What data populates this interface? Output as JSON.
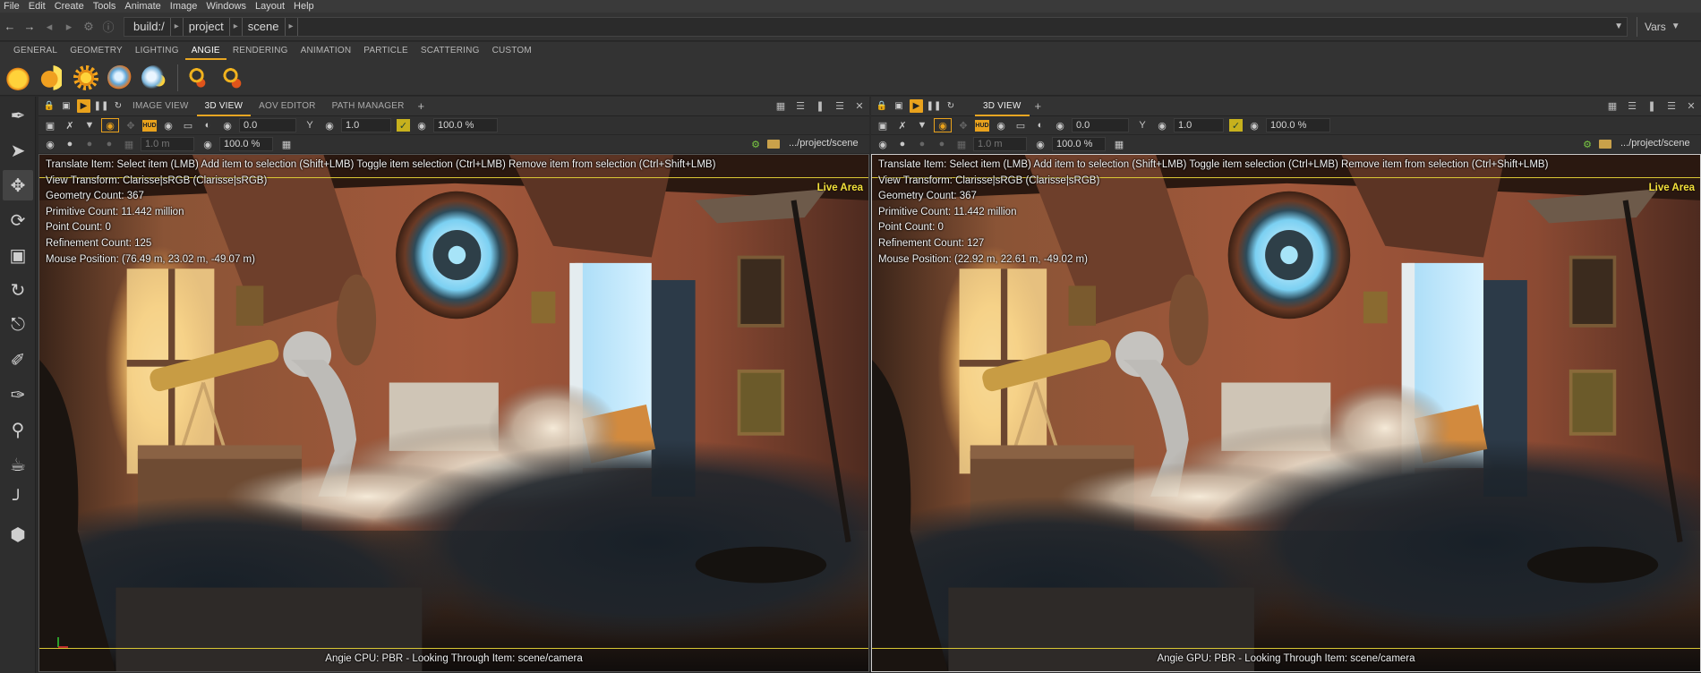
{
  "menu": [
    "File",
    "Edit",
    "Create",
    "Tools",
    "Animate",
    "Image",
    "Windows",
    "Layout",
    "Help"
  ],
  "breadcrumb": [
    "build:/",
    "project",
    "scene"
  ],
  "vars_label": "Vars",
  "shelf_tabs": [
    "GENERAL",
    "GEOMETRY",
    "LIGHTING",
    "ANGIE",
    "RENDERING",
    "ANIMATION",
    "PARTICLE",
    "SCATTERING",
    "CUSTOM"
  ],
  "active_shelf_tab": "ANGIE",
  "shelf_icons": [
    "sun-light-icon",
    "projector-icon",
    "gear-sun-icon",
    "globe-light-icon",
    "globe-sun-icon",
    "link-light-icon",
    "unlink-light-icon"
  ],
  "tools": [
    "eyedropper-icon",
    "select-arrow-icon",
    "translate-icon",
    "rotate-icon",
    "scale-icon",
    "rotate-dotted-icon",
    "stamp-icon",
    "paint-brush-icon",
    "brush-icon",
    "zoom-frame-icon",
    "teapot-icon",
    "ruler-icon",
    "hand-pick-icon"
  ],
  "left_panel": {
    "tabs": [
      "IMAGE VIEW",
      "3D VIEW",
      "AOV EDITOR",
      "PATH MANAGER"
    ],
    "active_tab": "3D VIEW",
    "exposure": "0.0",
    "gamma": "1.0",
    "zoom": "100.0 %",
    "unit": "1.0 m",
    "zoom2": "100.0 %",
    "path": ".../project/scene",
    "hud_lines": [
      "Translate Item: Select item (LMB)  Add item to selection (Shift+LMB)  Toggle item selection (Ctrl+LMB)  Remove item from selection (Ctrl+Shift+LMB)",
      "View Transform: Clarisse|sRGB (Clarisse|sRGB)",
      "Geometry Count: 367",
      "Primitive Count: 11.442 million",
      "Point Count: 0",
      "Refinement Count: 125",
      "Mouse Position:  (76.49 m, 23.02 m, -49.07 m)"
    ],
    "live_area": "Live Area",
    "caption": "Angie CPU: PBR - Looking Through Item: scene/camera"
  },
  "right_panel": {
    "tabs": [
      "3D VIEW"
    ],
    "active_tab": "3D VIEW",
    "exposure": "0.0",
    "gamma": "1.0",
    "zoom": "100.0 %",
    "unit": "1.0 m",
    "zoom2": "100.0 %",
    "path": ".../project/scene",
    "hud_lines": [
      "Translate Item: Select item (LMB)  Add item to selection (Shift+LMB)  Toggle item selection (Ctrl+LMB)  Remove item from selection (Ctrl+Shift+LMB)",
      "View Transform: Clarisse|sRGB (Clarisse|sRGB)",
      "Geometry Count: 367",
      "Primitive Count: 11.442 million",
      "Point Count: 0",
      "Refinement Count: 127",
      "Mouse Position:  (22.92 m, 22.61 m, -49.02 m)"
    ],
    "live_area": "Live Area",
    "caption": "Angie GPU: PBR - Looking Through Item: scene/camera"
  },
  "colors": {
    "accent": "#e7a622",
    "live_area": "#f3e03a"
  }
}
